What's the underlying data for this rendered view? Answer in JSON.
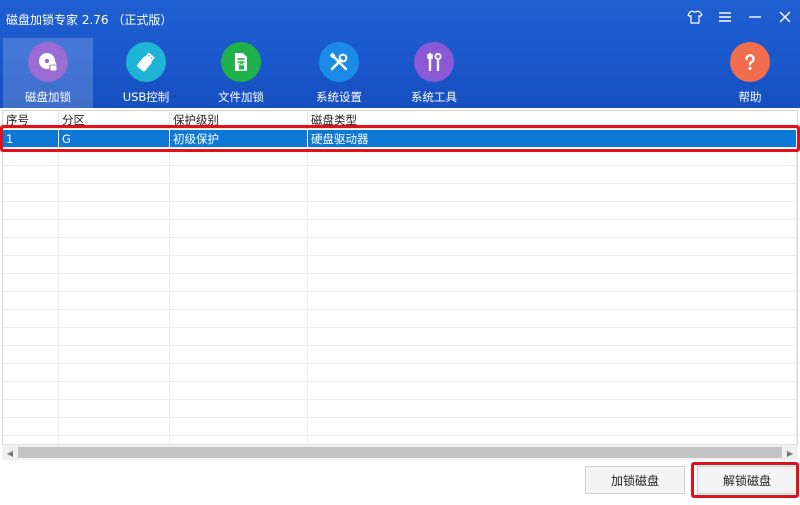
{
  "app": {
    "title": "磁盘加锁专家 2.76  （正式版）"
  },
  "window_controls": [
    {
      "name": "skin-icon"
    },
    {
      "name": "menu-icon"
    },
    {
      "name": "minimize-icon"
    },
    {
      "name": "close-icon"
    }
  ],
  "toolbar": {
    "items": [
      {
        "label": "磁盘加锁",
        "icon": "disk-lock-icon",
        "color": "#9b6cd3",
        "active": true
      },
      {
        "label": "USB控制",
        "icon": "usb-icon",
        "color": "#1fb3d6"
      },
      {
        "label": "文件加锁",
        "icon": "file-lock-icon",
        "color": "#1fb24a"
      },
      {
        "label": "系统设置",
        "icon": "tools-icon",
        "color": "#1c8be8"
      },
      {
        "label": "系统工具",
        "icon": "wrench-icon",
        "color": "#8a5ad6"
      },
      {
        "label": "帮助",
        "icon": "help-icon",
        "color": "#f26d4e"
      }
    ]
  },
  "table": {
    "columns": [
      "序号",
      "分区",
      "保护级别",
      "磁盘类型"
    ],
    "rows": [
      [
        "1",
        "G",
        "初级保护",
        "硬盘驱动器"
      ]
    ],
    "selected_row": 0,
    "empty_rows": 17
  },
  "buttons": {
    "lock": "加锁磁盘",
    "unlock": "解锁磁盘"
  },
  "colors": {
    "header": "#1a58cc",
    "selection": "#0e78d7",
    "highlight": "#e0111a"
  }
}
